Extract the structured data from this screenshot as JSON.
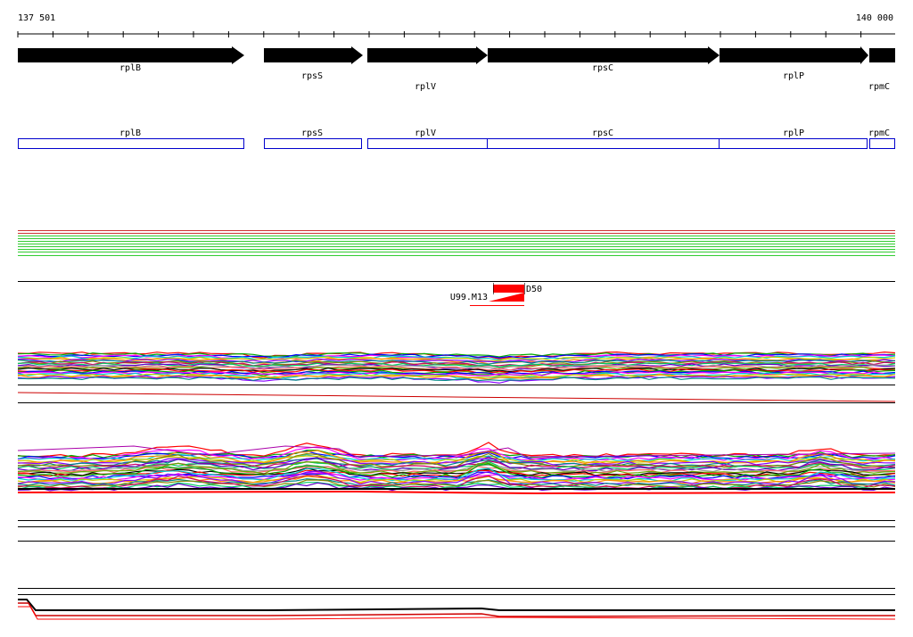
{
  "coordinates": {
    "start_label": "137 501",
    "end_label": "140 000"
  },
  "colors": {
    "arrow": "#000000",
    "cds_box": "#0000cc",
    "red_feature": "#ff0000",
    "green_track": "#22cc22",
    "red_track": "#cc0000"
  },
  "genes": [
    {
      "name": "rplB"
    },
    {
      "name": "rpsS"
    },
    {
      "name": "rplV"
    },
    {
      "name": "rpsC"
    },
    {
      "name": "rplP"
    },
    {
      "name": "rpmC"
    }
  ],
  "cds": [
    {
      "name": "rplB"
    },
    {
      "name": "rpsS"
    },
    {
      "name": "rplV"
    },
    {
      "name": "rpsC"
    },
    {
      "name": "rplP"
    },
    {
      "name": "rpmC"
    }
  ],
  "feature_labels": {
    "left": "U99.M13",
    "right": "D50"
  }
}
